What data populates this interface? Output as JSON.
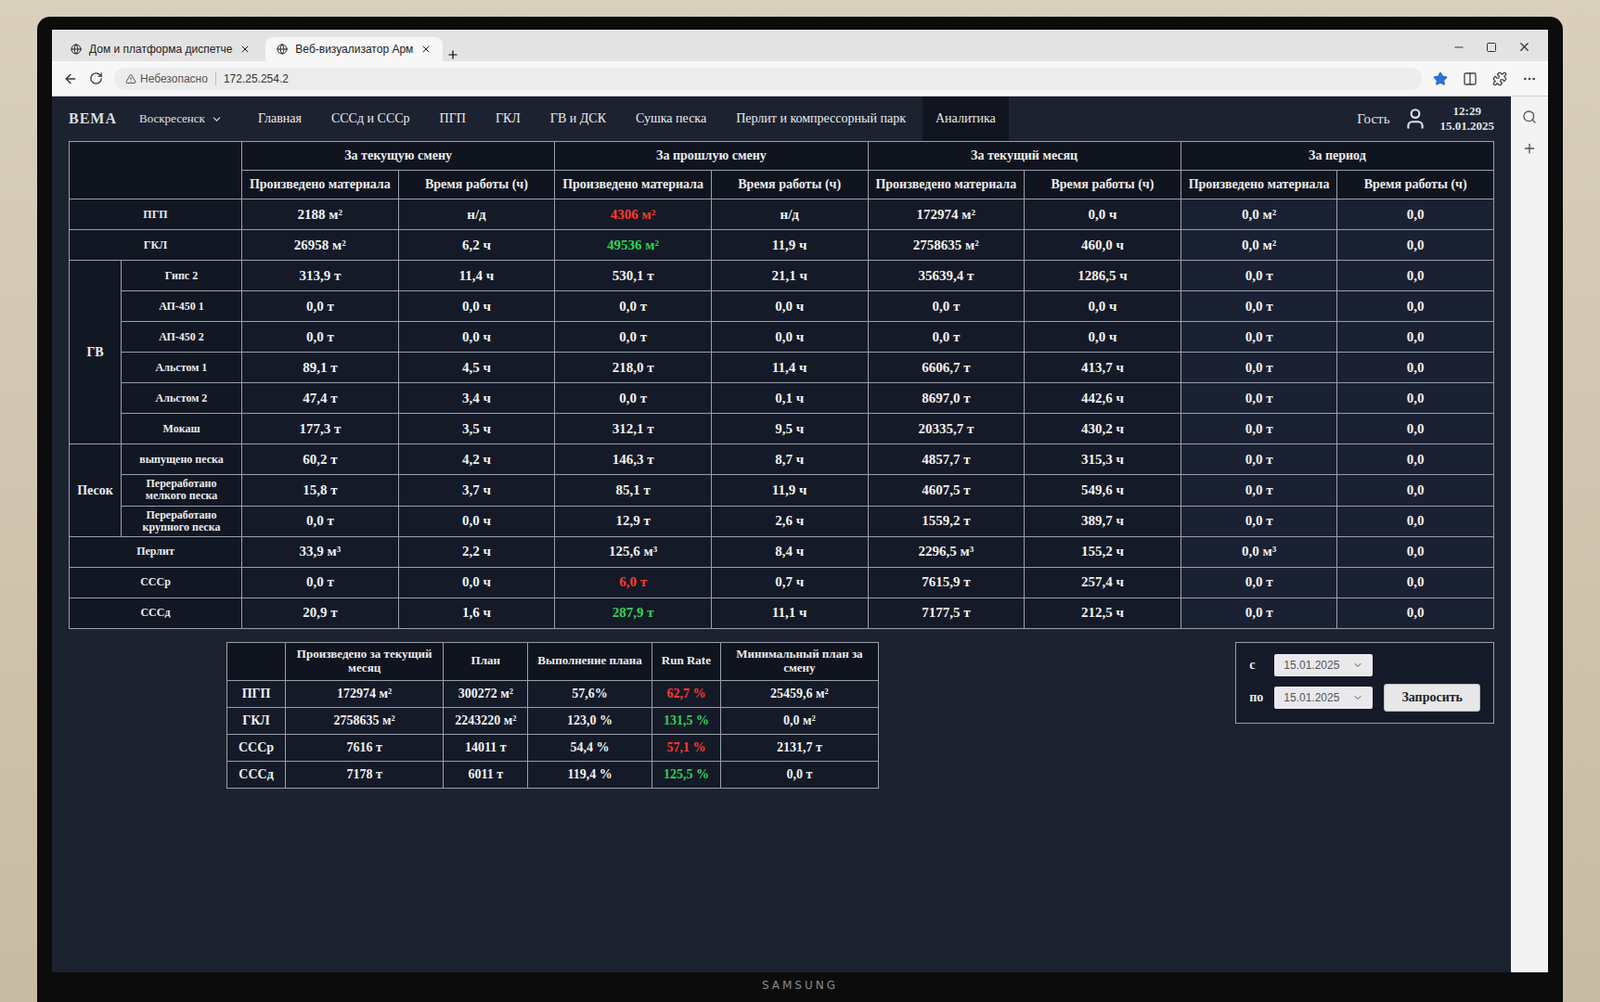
{
  "browser": {
    "tabs": [
      {
        "label": "Дом и платформа диспетче",
        "selected": false
      },
      {
        "label": "Веб-визуализатор Арм",
        "selected": true
      }
    ],
    "security": "Небезопасно",
    "address": "172.25.254.2"
  },
  "nav": {
    "logo": "ВЕМА",
    "location": "Воскресенск",
    "items": [
      {
        "label": "Главная",
        "selected": false
      },
      {
        "label": "СССд и СССр",
        "selected": false
      },
      {
        "label": "ПГП",
        "selected": false
      },
      {
        "label": "ГКЛ",
        "selected": false
      },
      {
        "label": "ГВ и ДСК",
        "selected": false
      },
      {
        "label": "Сушка песка",
        "selected": false
      },
      {
        "label": "Перлит и компрессорный парк",
        "selected": false
      },
      {
        "label": "Аналитика",
        "selected": true
      }
    ],
    "user": "Гость",
    "time": "12:29",
    "date": "15.01.2025"
  },
  "main_table": {
    "groups": [
      "За текущую смену",
      "За прошлую смену",
      "За текущий месяц",
      "За период"
    ],
    "subcolumns": [
      "Произведено материала",
      "Время работы (ч)"
    ],
    "rows": [
      {
        "group": "",
        "label": "ПГП",
        "cells": [
          "2188 м²",
          "н/д",
          "4306 м²",
          "н/д",
          "172974 м²",
          "0,0 ч",
          "0,0 м²",
          "0,0"
        ],
        "accent": {
          "cell": 2,
          "color": "#ff3b30"
        }
      },
      {
        "group": "",
        "label": "ГКЛ",
        "cells": [
          "26958 м²",
          "6,2 ч",
          "49536 м²",
          "11,9 ч",
          "2758635 м²",
          "460,0 ч",
          "0,0 м²",
          "0,0"
        ],
        "accent": {
          "cell": 2,
          "color": "#2fd158"
        }
      },
      {
        "group": "ГВ",
        "label": "Гипс 2",
        "cells": [
          "313,9 т",
          "11,4 ч",
          "530,1 т",
          "21,1 ч",
          "35639,4 т",
          "1286,5 ч",
          "0,0 т",
          "0,0"
        ]
      },
      {
        "group": "ГВ",
        "label": "АП-450 1",
        "cells": [
          "0,0 т",
          "0,0 ч",
          "0,0 т",
          "0,0 ч",
          "0,0 т",
          "0,0 ч",
          "0,0 т",
          "0,0"
        ]
      },
      {
        "group": "ГВ",
        "label": "АП-450 2",
        "cells": [
          "0,0 т",
          "0,0 ч",
          "0,0 т",
          "0,0 ч",
          "0,0 т",
          "0,0 ч",
          "0,0 т",
          "0,0"
        ]
      },
      {
        "group": "ГВ",
        "label": "Альстом 1",
        "cells": [
          "89,1 т",
          "4,5 ч",
          "218,0 т",
          "11,4 ч",
          "6606,7 т",
          "413,7 ч",
          "0,0 т",
          "0,0"
        ]
      },
      {
        "group": "ГВ",
        "label": "Альстом 2",
        "cells": [
          "47,4 т",
          "3,4 ч",
          "0,0 т",
          "0,1 ч",
          "8697,0 т",
          "442,6 ч",
          "0,0 т",
          "0,0"
        ]
      },
      {
        "group": "ГВ",
        "label": "Мокаш",
        "cells": [
          "177,3 т",
          "3,5 ч",
          "312,1 т",
          "9,5 ч",
          "20335,7 т",
          "430,2 ч",
          "0,0 т",
          "0,0"
        ]
      },
      {
        "group": "Песок",
        "label": "выпущено песка",
        "cells": [
          "60,2 т",
          "4,2 ч",
          "146,3 т",
          "8,7 ч",
          "4857,7 т",
          "315,3 ч",
          "0,0 т",
          "0,0"
        ]
      },
      {
        "group": "Песок",
        "label": "Переработано мелкого песка",
        "cells": [
          "15,8 т",
          "3,7 ч",
          "85,1 т",
          "11,9 ч",
          "4607,5 т",
          "549,6 ч",
          "0,0 т",
          "0,0"
        ]
      },
      {
        "group": "Песок",
        "label": "Переработано крупного песка",
        "cells": [
          "0,0 т",
          "0,0 ч",
          "12,9 т",
          "2,6 ч",
          "1559,2 т",
          "389,7 ч",
          "0,0 т",
          "0,0"
        ]
      },
      {
        "group": "",
        "label": "Перлит",
        "cells": [
          "33,9 м³",
          "2,2 ч",
          "125,6 м³",
          "8,4 ч",
          "2296,5 м³",
          "155,2 ч",
          "0,0 м³",
          "0,0"
        ]
      },
      {
        "group": "",
        "label": "СССр",
        "cells": [
          "0,0 т",
          "0,0 ч",
          "6,0 т",
          "0,7 ч",
          "7615,9 т",
          "257,4 ч",
          "0,0 т",
          "0,0"
        ],
        "accent": {
          "cell": 2,
          "color": "#ff3b30"
        }
      },
      {
        "group": "",
        "label": "СССд",
        "cells": [
          "20,9 т",
          "1,6 ч",
          "287,9 т",
          "11,1 ч",
          "7177,5 т",
          "212,5 ч",
          "0,0 т",
          "0,0"
        ],
        "accent": {
          "cell": 2,
          "color": "#2fd158"
        }
      }
    ]
  },
  "summary": {
    "columns": [
      "Произведено за текущий месяц",
      "План",
      "Выполнение плана",
      "Run Rate",
      "Минимальный план за смену"
    ],
    "rows": [
      {
        "label": "ПГП",
        "produced": "172974 м²",
        "plan": "300272 м²",
        "completion": "57,6%",
        "run_rate": "62,7 %",
        "run_rate_color": "#ff3b30",
        "min_plan": "25459,6 м²"
      },
      {
        "label": "ГКЛ",
        "produced": "2758635 м²",
        "plan": "2243220 м²",
        "completion": "123,0 %",
        "run_rate": "131,5 %",
        "run_rate_color": "#2fd158",
        "min_plan": "0,0 м²"
      },
      {
        "label": "СССр",
        "produced": "7616 т",
        "plan": "14011 т",
        "completion": "54,4 %",
        "run_rate": "57,1 %",
        "run_rate_color": "#ff3b30",
        "min_plan": "2131,7 т"
      },
      {
        "label": "СССд",
        "produced": "7178 т",
        "plan": "6011 т",
        "completion": "119,4 %",
        "run_rate": "125,5 %",
        "run_rate_color": "#2fd158",
        "min_plan": "0,0 т"
      }
    ]
  },
  "period_filter": {
    "from_label": "с",
    "from": "15.01.2025",
    "to_label": "по",
    "to": "15.01.2025",
    "button": "Запросить"
  },
  "monitor": {
    "brand": "SAMSUNG"
  }
}
